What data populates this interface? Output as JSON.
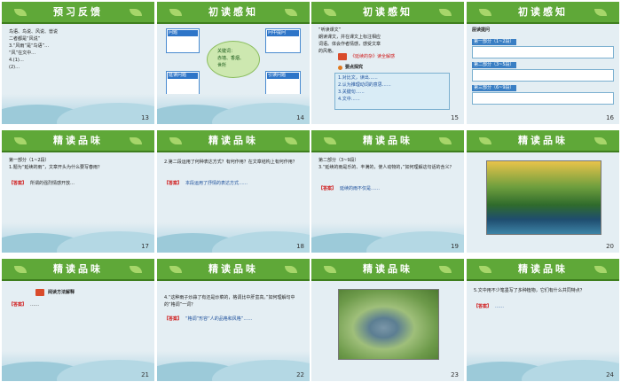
{
  "slides": [
    {
      "num": "13",
      "title": "预习反馈",
      "lines": [
        "1.写作",
        "  …",
        "2.…",
        "3.…"
      ],
      "body": "鸟语、鸟说、风说、兽说\n二者都是“风说”\n3.“风雨”是“鸟语”…\n“风”在文中…\n4.(1)…\n(2)…"
    },
    {
      "num": "14",
      "title": "初读感知",
      "cloud": "关键词：\n赤墙、香烟、\n世所",
      "tag1t": "问题",
      "tag2t": "延读问题",
      "tag3t": "问中提问",
      "tag4t": "引读问题"
    },
    {
      "num": "15",
      "title": "初读感知",
      "intro": "“听读课文”\n朗读课文，并在课文上标注相应\n词语。体会作者情感，感受文章\n的风格。",
      "tag": "《延续的杂》读全解感",
      "sub": "要点探究",
      "points": "1.对比文，读出……\n2.认为推理动词的意思……\n3.关键句……\n4.文中……"
    },
    {
      "num": "16",
      "title": "初读感知",
      "sec": "层读提问",
      "p1": "第一部分（1~2段）",
      "p2": "第二部分（3~5段）",
      "p3": "第三部分（6~9段）"
    },
    {
      "num": "17",
      "title": "精读品味",
      "q": "第一部分（1~2段）\n1.题为“延续的雨”，文章开头为什么要写春雨？",
      "ans": "【答案】",
      "body": "所谓的强烈情感开放…"
    },
    {
      "num": "18",
      "title": "精读品味",
      "q": "2.第二段运用了何种表达方式？有何作用？在文章结构上有何作用？",
      "ans": "【答案】",
      "body": "本段运用了抒情的表达方式……"
    },
    {
      "num": "19",
      "title": "精读品味",
      "q": "第二部分（3~9段）\n3.“延续的雨是乐的、丰满的，使人动物的，”如何理解这句话的含义？",
      "ans": "【答案】",
      "body": "延续的雨不仅是……"
    },
    {
      "num": "20",
      "title": "精读品味"
    },
    {
      "num": "21",
      "title": "精读品味",
      "tag": "阅读方法解释",
      "ans": "【答案】",
      "body": "……"
    },
    {
      "num": "22",
      "title": "精读品味",
      "q": "4.“这种雨子炒蒜了有还是炒菜的，格调比中肝蛮高。”如何理解句中的“格调”一词？",
      "ans": "【答案】",
      "body": "“格调”形容“人的品格和风格”……"
    },
    {
      "num": "23",
      "title": "精读品味"
    },
    {
      "num": "24",
      "title": "精读品味",
      "q": "5.文中用不少笔墨写了多种植物，它们有什么共同特点？",
      "ans": "【答案】",
      "body": "……"
    }
  ]
}
